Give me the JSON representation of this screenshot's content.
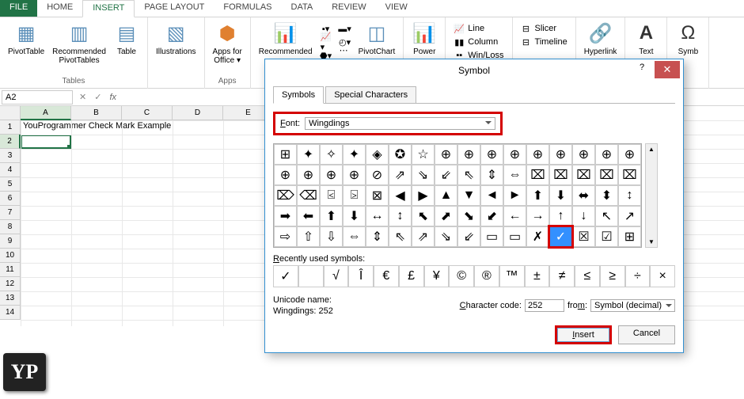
{
  "tabs": {
    "file": "FILE",
    "home": "HOME",
    "insert": "INSERT",
    "pagelayout": "PAGE LAYOUT",
    "formulas": "FORMULAS",
    "data": "DATA",
    "review": "REVIEW",
    "view": "VIEW"
  },
  "ribbon": {
    "tables": {
      "pivot": "PivotTable",
      "rec": "Recommended\nPivotTables",
      "table": "Table",
      "group": "Tables"
    },
    "illus": {
      "label": "Illustrations"
    },
    "apps": {
      "label": "Apps for\nOffice ▾",
      "group": "Apps"
    },
    "charts": {
      "rec": "Recommended",
      "pivotchart": "PivotChart"
    },
    "power": "Power",
    "sparklines": {
      "line": "Line",
      "column": "Column",
      "winloss": "Win/Loss"
    },
    "filters": {
      "slicer": "Slicer",
      "timeline": "Timeline"
    },
    "links": {
      "hyperlink": "Hyperlink"
    },
    "text": "Text",
    "symbols": "Symb"
  },
  "namebox": "A2",
  "columns": [
    "A",
    "B",
    "C",
    "D",
    "E"
  ],
  "rows": [
    "1",
    "2",
    "3",
    "4",
    "5",
    "6",
    "7",
    "8",
    "9",
    "10",
    "11",
    "12",
    "13",
    "14"
  ],
  "cell_a1": "YouProgrammer Check Mark Example",
  "dialog": {
    "title": "Symbol",
    "tab_symbols": "Symbols",
    "tab_special": "Special Characters",
    "font_label": "Font:",
    "font_value": "Wingdings",
    "grid": [
      [
        "⊞",
        "✦",
        "✧",
        "✦",
        "◈",
        "✪",
        "☆",
        "⊕",
        "⊕",
        "⊕",
        "⊕",
        "⊕",
        "⊕",
        "⊕",
        "⊕",
        "⊕"
      ],
      [
        "⊕",
        "⊕",
        "⊕",
        "⊕",
        "⊘",
        "⇗",
        "⇘",
        "⇙",
        "⇖",
        "⇕",
        "⇔",
        "⌧",
        "⌧",
        "⌧",
        "⌧",
        "⌧"
      ],
      [
        "⌦",
        "⌫",
        "⍃",
        "⍄",
        "⊠",
        "◀",
        "▶",
        "▲",
        "▼",
        "◄",
        "►",
        "⬆",
        "⬇",
        "⬌",
        "⬍",
        "↕"
      ],
      [
        "➡",
        "⬅",
        "⬆",
        "⬇",
        "↔",
        "↕",
        "⬉",
        "⬈",
        "⬊",
        "⬋",
        "←",
        "→",
        "↑",
        "↓",
        "↖",
        "↗"
      ],
      [
        "⇨",
        "⇧",
        "⇩",
        "⇔",
        "⇕",
        "⇖",
        "⇗",
        "⇘",
        "⇙",
        "▭",
        "▭",
        "✗",
        "✓",
        "☒",
        "☑",
        "⊞"
      ]
    ],
    "selected_row": 4,
    "selected_col": 12,
    "recent_label": "Recently used symbols:",
    "recent": [
      "✓",
      "",
      "√",
      "Î",
      "€",
      "£",
      "¥",
      "©",
      "®",
      "™",
      "±",
      "≠",
      "≤",
      "≥",
      "÷",
      "×"
    ],
    "uni_name_label": "Unicode name:",
    "uni_name": "Wingdings: 252",
    "char_code_label": "Character code:",
    "char_code": "252",
    "from_label": "from:",
    "from_value": "Symbol (decimal)",
    "insert": "Insert",
    "cancel": "Cancel"
  },
  "logo": "YP"
}
